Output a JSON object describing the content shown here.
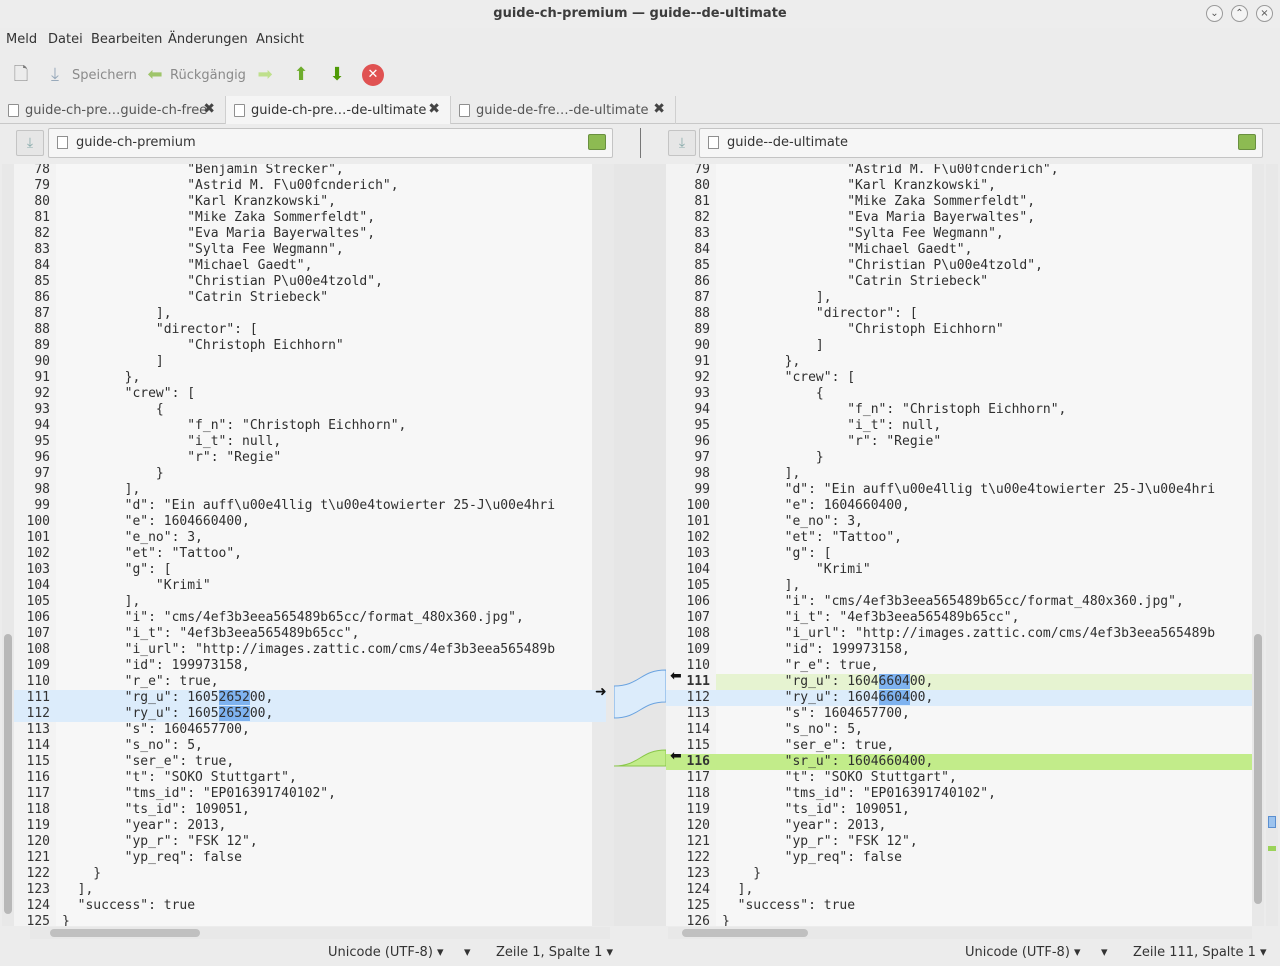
{
  "window": {
    "title": "guide-ch-premium — guide--de-ultimate"
  },
  "menu": [
    "Meld",
    "Datei",
    "Bearbeiten",
    "Änderungen",
    "Ansicht"
  ],
  "toolbar": {
    "save": "Speichern",
    "undo": "Rückgängig"
  },
  "tabs": [
    "guide-ch-pre…guide-ch-free",
    "guide-ch-pre…-de-ultimate",
    "guide-de-fre…-de-ultimate"
  ],
  "left": {
    "file": "guide-ch-premium",
    "first_line": 78,
    "lines": [
      "                \"Benjamin Strecker\",",
      "                \"Astrid M. F\\u00fcnderich\",",
      "                \"Karl Kranzkowski\",",
      "                \"Mike Zaka Sommerfeldt\",",
      "                \"Eva Maria Bayerwaltes\",",
      "                \"Sylta Fee Wegmann\",",
      "                \"Michael Gaedt\",",
      "                \"Christian P\\u00e4tzold\",",
      "                \"Catrin Striebeck\"",
      "            ],",
      "            \"director\": [",
      "                \"Christoph Eichhorn\"",
      "            ]",
      "        },",
      "        \"crew\": [",
      "            {",
      "                \"f_n\": \"Christoph Eichhorn\",",
      "                \"i_t\": null,",
      "                \"r\": \"Regie\"",
      "            }",
      "        ],",
      "        \"d\": \"Ein auff\\u00e4llig t\\u00e4towierter 25-J\\u00e4hri",
      "        \"e\": 1604660400,",
      "        \"e_no\": 3,",
      "        \"et\": \"Tattoo\",",
      "        \"g\": [",
      "            \"Krimi\"",
      "        ],",
      "        \"i\": \"cms/4ef3b3eea565489b65cc/format_480x360.jpg\",",
      "        \"i_t\": \"4ef3b3eea565489b65cc\",",
      "        \"i_url\": \"http://images.zattic.com/cms/4ef3b3eea565489b",
      "        \"id\": 199973158,",
      "        \"r_e\": true,",
      "        \"rg_u\": 1605265200,",
      "        \"ry_u\": 1605265200,",
      "        \"s\": 1604657700,",
      "        \"s_no\": 5,",
      "        \"ser_e\": true,",
      "        \"t\": \"SOKO Stuttgart\",",
      "        \"tms_id\": \"EP016391740102\",",
      "        \"ts_id\": 109051,",
      "        \"year\": 2013,",
      "        \"yp_r\": \"FSK 12\",",
      "        \"yp_req\": false",
      "    }",
      "  ],",
      "  \"success\": true",
      "}"
    ]
  },
  "right": {
    "file": "guide--de-ultimate",
    "first_line": 79,
    "lines": [
      "                \"Astrid M. F\\u00fcnderich\",",
      "                \"Karl Kranzkowski\",",
      "                \"Mike Zaka Sommerfeldt\",",
      "                \"Eva Maria Bayerwaltes\",",
      "                \"Sylta Fee Wegmann\",",
      "                \"Michael Gaedt\",",
      "                \"Christian P\\u00e4tzold\",",
      "                \"Catrin Striebeck\"",
      "            ],",
      "            \"director\": [",
      "                \"Christoph Eichhorn\"",
      "            ]",
      "        },",
      "        \"crew\": [",
      "            {",
      "                \"f_n\": \"Christoph Eichhorn\",",
      "                \"i_t\": null,",
      "                \"r\": \"Regie\"",
      "            }",
      "        ],",
      "        \"d\": \"Ein auff\\u00e4llig t\\u00e4towierter 25-J\\u00e4hri",
      "        \"e\": 1604660400,",
      "        \"e_no\": 3,",
      "        \"et\": \"Tattoo\",",
      "        \"g\": [",
      "            \"Krimi\"",
      "        ],",
      "        \"i\": \"cms/4ef3b3eea565489b65cc/format_480x360.jpg\",",
      "        \"i_t\": \"4ef3b3eea565489b65cc\",",
      "        \"i_url\": \"http://images.zattic.com/cms/4ef3b3eea565489b",
      "        \"id\": 199973158,",
      "        \"r_e\": true,",
      "        \"rg_u\": 1604660400,",
      "        \"ry_u\": 1604660400,",
      "        \"s\": 1604657700,",
      "        \"s_no\": 5,",
      "        \"ser_e\": true,",
      "        \"sr_u\": 1604660400,",
      "        \"t\": \"SOKO Stuttgart\",",
      "        \"tms_id\": \"EP016391740102\",",
      "        \"ts_id\": 109051,",
      "        \"year\": 2013,",
      "        \"yp_r\": \"FSK 12\",",
      "        \"yp_req\": false",
      "    }",
      "  ],",
      "  \"success\": true",
      "}"
    ]
  },
  "status_left": {
    "encoding": "Unicode (UTF-8)",
    "position": "Zeile 1, Spalte 1"
  },
  "status_right": {
    "encoding": "Unicode (UTF-8)",
    "position": "Zeile 111, Spalte 1"
  }
}
